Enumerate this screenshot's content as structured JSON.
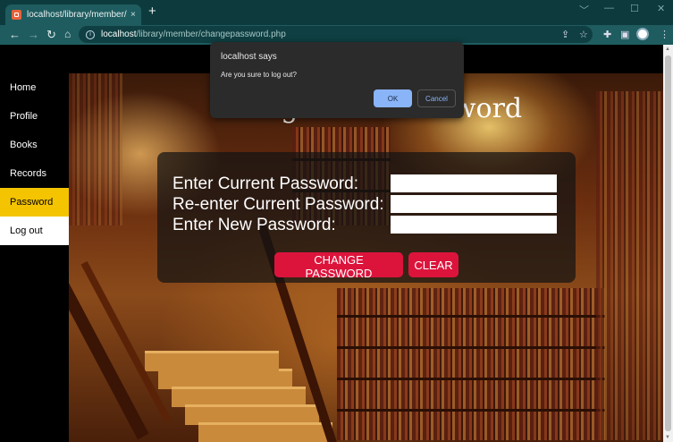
{
  "browser": {
    "tab_title": "localhost/library/member/change",
    "tab_close": "×",
    "new_tab": "+",
    "url_host": "localhost",
    "url_path": "/library/member/changepassword.php",
    "window_controls": [
      "﹀",
      "—",
      "☐",
      "✕"
    ]
  },
  "sidebar": {
    "items": [
      {
        "label": "Home"
      },
      {
        "label": "Profile"
      },
      {
        "label": "Books"
      },
      {
        "label": "Records"
      },
      {
        "label": "Password"
      },
      {
        "label": "Log out"
      }
    ]
  },
  "main": {
    "heading": "Change Your Password",
    "labels": {
      "current": "Enter Current Password:",
      "reenter": "Re-enter Current Password:",
      "new": "Enter New Password:"
    },
    "buttons": {
      "change": "CHANGE PASSWORD",
      "clear": "CLEAR"
    }
  },
  "dialog": {
    "title": "localhost says",
    "message": "Are you sure to log out?",
    "ok": "OK",
    "cancel": "Cancel"
  },
  "colors": {
    "active_nav": "#f5c400",
    "button": "#dc143c",
    "dialog_ok": "#8ab4f8"
  },
  "icons": [
    "back-icon",
    "forward-icon",
    "reload-icon",
    "home-icon",
    "info-icon",
    "share-icon",
    "star-icon",
    "extensions-icon",
    "sidepanel-icon",
    "menu-icon"
  ]
}
